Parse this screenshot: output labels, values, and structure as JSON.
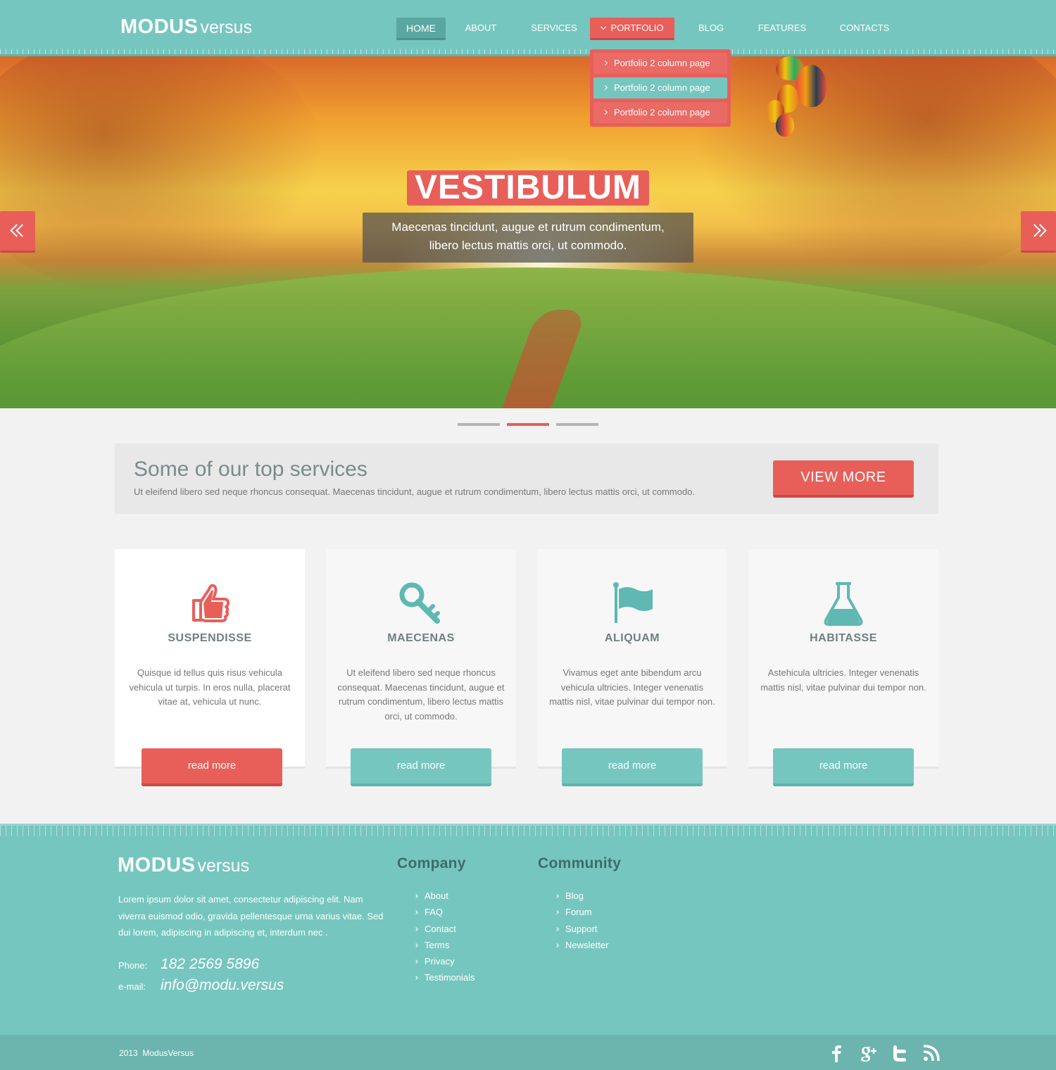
{
  "brand": {
    "bold": "MODUS",
    "light": "versus"
  },
  "nav": {
    "items": [
      {
        "label": "HOME"
      },
      {
        "label": "ABOUT"
      },
      {
        "label": "SERVICES"
      },
      {
        "label": "PORTFOLIO"
      },
      {
        "label": "BLOG"
      },
      {
        "label": "FEATURES"
      },
      {
        "label": "CONTACTS"
      }
    ],
    "active": "HOME",
    "open": "PORTFOLIO",
    "dropdown": [
      {
        "label": "Portfolio 2 column page"
      },
      {
        "label": "Portfolio 2 column page"
      },
      {
        "label": "Portfolio 2 column page"
      }
    ]
  },
  "hero": {
    "title": "VESTIBULUM",
    "subtitle_line1": "Maecenas tincidunt, augue et rutrum condimentum,",
    "subtitle_line2": "libero lectus mattis orci, ut commodo.",
    "prev_icon": "double-chevron-left-icon",
    "next_icon": "double-chevron-right-icon",
    "slides_total": 3,
    "slide_active": 2
  },
  "services_banner": {
    "title": "Some of our top services",
    "text": "Ut eleifend libero sed neque rhoncus consequat. Maecenas tincidunt, augue et rutrum condimentum, libero lectus mattis orci, ut commodo.",
    "button": "VIEW MORE"
  },
  "cards": [
    {
      "icon": "thumbs-up-icon",
      "title": "SUSPENDISSE",
      "text": "Quisque id tellus quis risus vehicula vehicula ut turpis. In eros nulla, placerat vitae at, vehicula ut nunc.",
      "button": "read more"
    },
    {
      "icon": "key-icon",
      "title": "MAECENAS",
      "text": "Ut eleifend libero sed neque rhoncus consequat. Maecenas tincidunt, augue et rutrum condimentum, libero lectus mattis orci, ut commodo.",
      "button": "read more"
    },
    {
      "icon": "flag-icon",
      "title": "ALIQUAM",
      "text": "Vivamus eget ante bibendum arcu vehicula ultricies. Integer venenatis mattis nisl, vitae pulvinar dui tempor non.",
      "button": "read more"
    },
    {
      "icon": "flask-icon",
      "title": "HABITASSE",
      "text": "Astehicula ultricies. Integer venenatis mattis nisl, vitae pulvinar dui tempor non.",
      "button": "read more"
    }
  ],
  "footer": {
    "about": "Lorem ipsum dolor sit amet, consectetur adipiscing elit. Nam viverra euismod odio, gravida pellentesque urna varius vitae. Sed dui lorem, adipiscing in adipiscing et, interdum nec .",
    "phone_label": "Phone:",
    "phone": "182 2569 5896",
    "email_label": "e-mail:",
    "email": "info@modu.versus",
    "company": {
      "title": "Company",
      "links": [
        "About",
        "FAQ",
        "Contact",
        "Terms",
        "Privacy",
        "Testimonials"
      ]
    },
    "community": {
      "title": "Community",
      "links": [
        "Blog",
        "Forum",
        "Support",
        "Newsletter"
      ]
    },
    "copyright": "2013  ModusVersus",
    "social": [
      "facebook-icon",
      "google-plus-icon",
      "twitter-icon",
      "rss-icon"
    ]
  },
  "colors": {
    "teal": "#76c6c0",
    "teal_dark": "#5aa7a2",
    "red": "#e85f5a",
    "red_dark": "#c94a46",
    "footer_heading": "#3f6b69"
  }
}
